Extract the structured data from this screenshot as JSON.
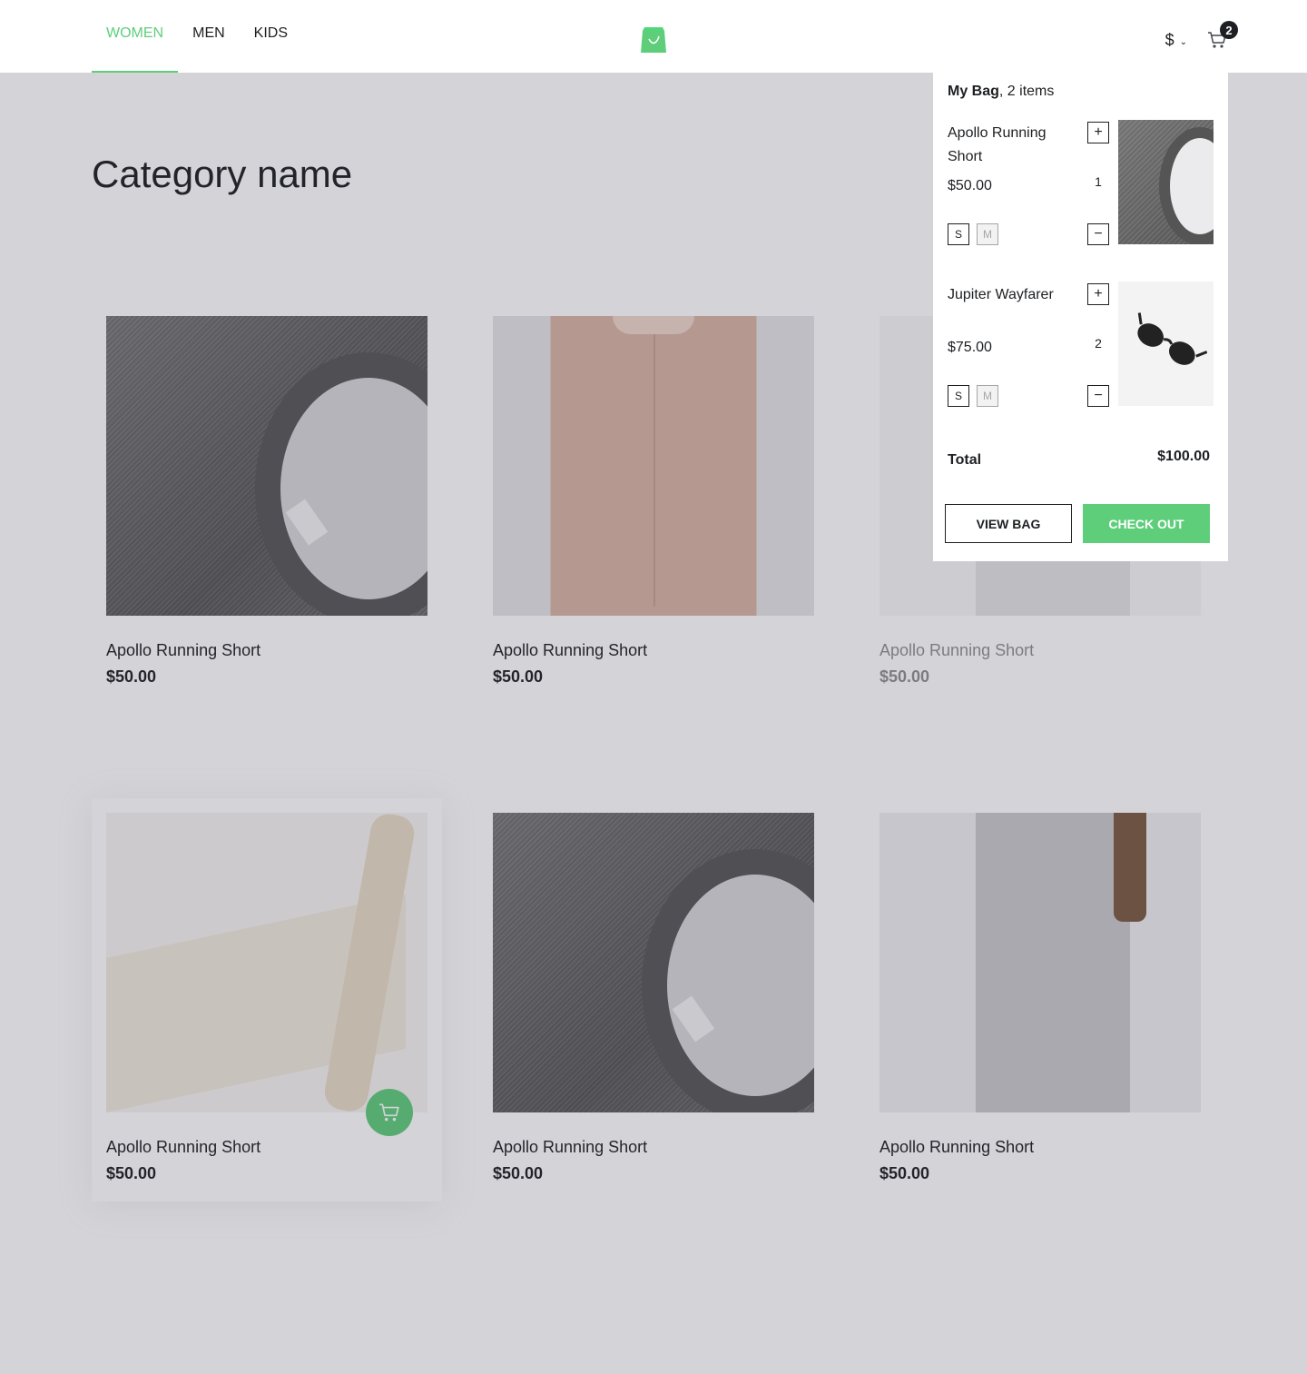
{
  "header": {
    "nav": [
      {
        "label": "WOMEN",
        "active": true
      },
      {
        "label": "MEN",
        "active": false
      },
      {
        "label": "KIDS",
        "active": false
      }
    ],
    "logo_icon": "shopping-bag-logo-icon",
    "currency_symbol": "$",
    "cart_count": "2"
  },
  "category": {
    "title": "Category name"
  },
  "products": [
    {
      "name": "Apollo Running Short",
      "price": "$50.00",
      "image": "gray-sweater",
      "in_stock": true
    },
    {
      "name": "Apollo Running Short",
      "price": "$50.00",
      "image": "pink-sweater",
      "in_stock": true
    },
    {
      "name": "Apollo Running Short",
      "price": "$50.00",
      "image": "gray-dress",
      "in_stock": false
    },
    {
      "name": "Apollo Running Short",
      "price": "$50.00",
      "image": "canvas-bag",
      "in_stock": true,
      "hovered": true
    },
    {
      "name": "Apollo Running Short",
      "price": "$50.00",
      "image": "gray-sweater",
      "in_stock": true
    },
    {
      "name": "Apollo Running Short",
      "price": "$50.00",
      "image": "gray-dress",
      "in_stock": true
    }
  ],
  "minicart": {
    "heading_bold": "My Bag",
    "heading_rest": ", 2 items",
    "items": [
      {
        "name": "Apollo Running Short",
        "price": "$50.00",
        "quantity": "1",
        "sizes": [
          "S",
          "M"
        ],
        "selected_size": "S",
        "image": "gray-sweater"
      },
      {
        "name": "Jupiter Wayfarer",
        "price": "$75.00",
        "quantity": "2",
        "sizes": [
          "S",
          "M"
        ],
        "selected_size": "S",
        "image": "sunglasses"
      }
    ],
    "total_label": "Total",
    "total_value": "$100.00",
    "view_bag_label": "VIEW BAG",
    "checkout_label": "CHECK OUT",
    "plus_symbol": "+",
    "minus_symbol": "−"
  },
  "colors": {
    "accent": "#5ece7b",
    "text": "#1d1f22",
    "overlay": "rgba(57,55,72,0.22)"
  }
}
